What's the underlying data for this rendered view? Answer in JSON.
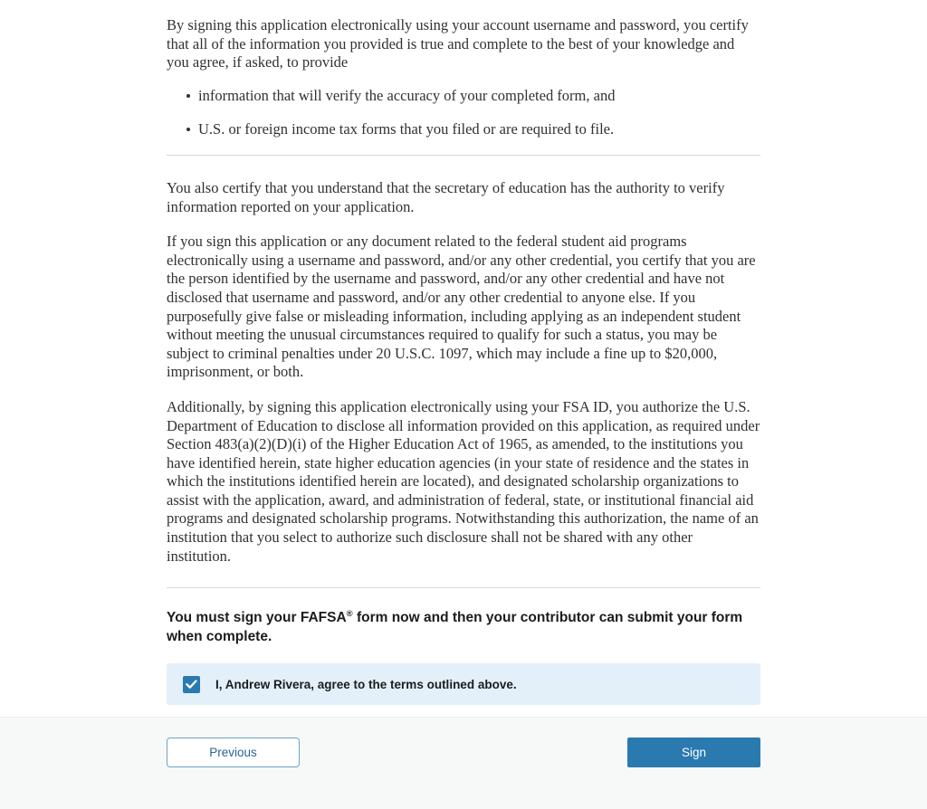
{
  "main": {
    "intro_paragraph": "By signing this application electronically using your account username and password, you certify that all of the information you provided is true and complete to the best of your knowledge and you agree, if asked, to provide",
    "bullets": [
      "information that will verify the accuracy of your completed form, and",
      "U.S. or foreign income tax forms that you filed or are required to file."
    ],
    "paragraphs": [
      "You also certify that you understand that the secretary of education has the authority to verify information reported on your application.",
      "If you sign this application or any document related to the federal student aid programs electronically using a username and password, and/or any other credential, you certify that you are the person identified by the username and password, and/or any other credential and have not disclosed that username and password, and/or any other credential to anyone else. If you purposefully give false or misleading information, including applying as an independent student without meeting the unusual circumstances required to qualify for such a status, you may be subject to criminal penalties under 20 U.S.C. 1097, which may include a fine up to $20,000, imprisonment, or both.",
      "Additionally, by signing this application electronically using your FSA ID, you authorize the U.S. Department of Education to disclose all information provided on this application, as required under Section 483(a)(2)(D)(i) of the Higher Education Act of 1965, as amended, to the institutions you have identified herein, state higher education agencies (in your state of residence and the states in which the institutions identified herein are located), and designated scholarship organizations to assist with the application, award, and administration of federal, state, or institutional financial aid programs and designated scholarship programs. Notwithstanding this authorization, the name of an institution that you select to authorize such disclosure shall not be shared with any other institution."
    ],
    "sign_heading_before": "You must sign your FAFSA",
    "sign_heading_mark": "®",
    "sign_heading_after": " form now and then your contributor can submit your form when complete.",
    "agree_checkbox_label": "I, Andrew Rivera, agree to the terms outlined above.",
    "agree_checkbox_checked": true
  },
  "footer": {
    "previous_label": "Previous",
    "sign_label": "Sign"
  },
  "colors": {
    "accent_blue": "#2a7ab0",
    "link_blue": "#2a6496",
    "panel_blue": "#e3f0f9",
    "footer_gray": "#f7f8f8",
    "divider_gray": "#d6d7d9"
  }
}
